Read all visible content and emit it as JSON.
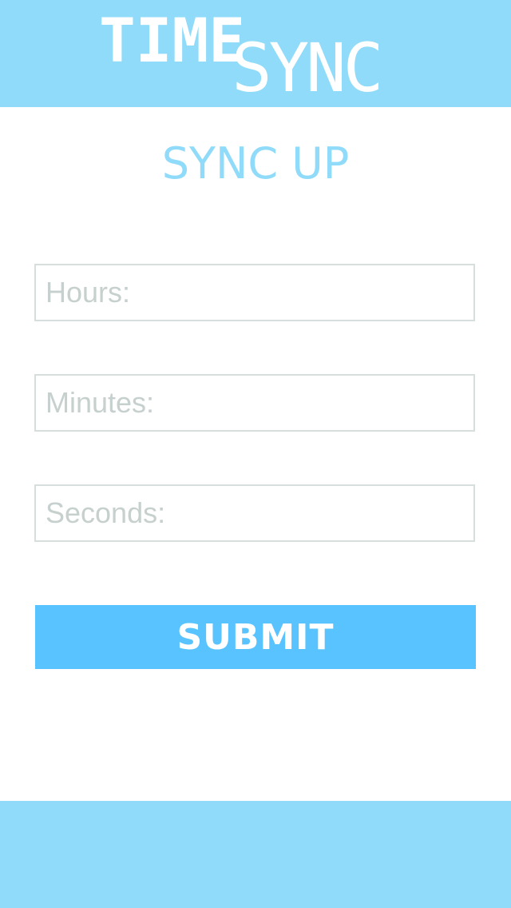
{
  "header": {
    "logo_word_1": "TIME",
    "logo_word_2": "SYNC",
    "background_color": "#8fdbf9"
  },
  "main": {
    "title": "SYNC UP",
    "fields": {
      "hours": {
        "placeholder": "Hours:",
        "value": ""
      },
      "minutes": {
        "placeholder": "Minutes:",
        "value": ""
      },
      "seconds": {
        "placeholder": "Seconds:",
        "value": ""
      }
    },
    "submit_label": "SUBMIT",
    "submit_color": "#58c3fe"
  },
  "footer": {
    "background_color": "#8fdbf9"
  }
}
